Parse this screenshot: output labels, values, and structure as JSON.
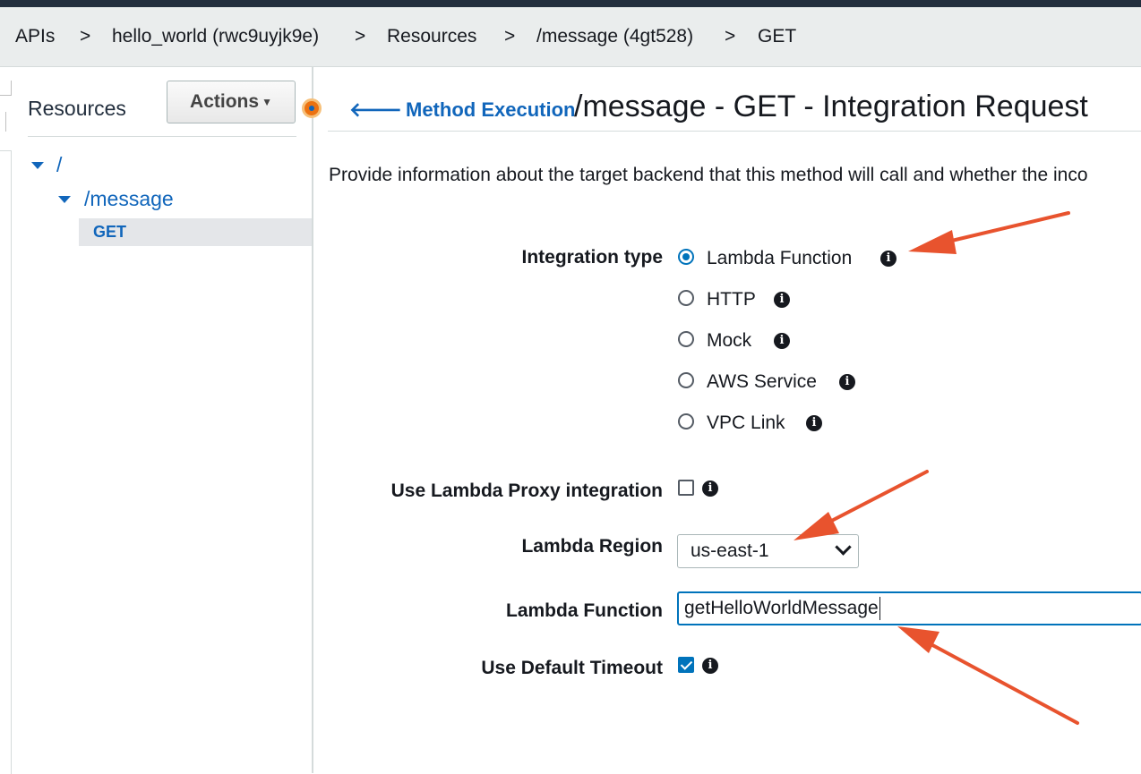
{
  "breadcrumb": {
    "items": [
      "APIs",
      "hello_world (rwc9uyjk9e)",
      "Resources",
      "/message (4gt528)",
      "GET"
    ],
    "separator": ">"
  },
  "sidebar": {
    "title": "Resources",
    "actions_label": "Actions",
    "tree": {
      "root": "/",
      "child": "/message",
      "method": "GET"
    }
  },
  "header": {
    "back_link": "Method Execution",
    "back_icon": "arrow-left-icon",
    "title": "/message - GET - Integration Request"
  },
  "description": "Provide information about the target backend that this method will call and whether the inco",
  "form": {
    "integration_type_label": "Integration type",
    "integration_options": [
      "Lambda Function",
      "HTTP",
      "Mock",
      "AWS Service",
      "VPC Link"
    ],
    "integration_selected": "Lambda Function",
    "proxy_label": "Use Lambda Proxy integration",
    "proxy_checked": false,
    "region_label": "Lambda Region",
    "region_value": "us-east-1",
    "function_label": "Lambda Function",
    "function_value": "getHelloWorldMessage",
    "timeout_label": "Use Default Timeout",
    "timeout_checked": true
  },
  "colors": {
    "link": "#1166bb",
    "accent": "#0073bb",
    "annotation_arrow": "#e8532e",
    "status_dot": "#ec7211"
  }
}
